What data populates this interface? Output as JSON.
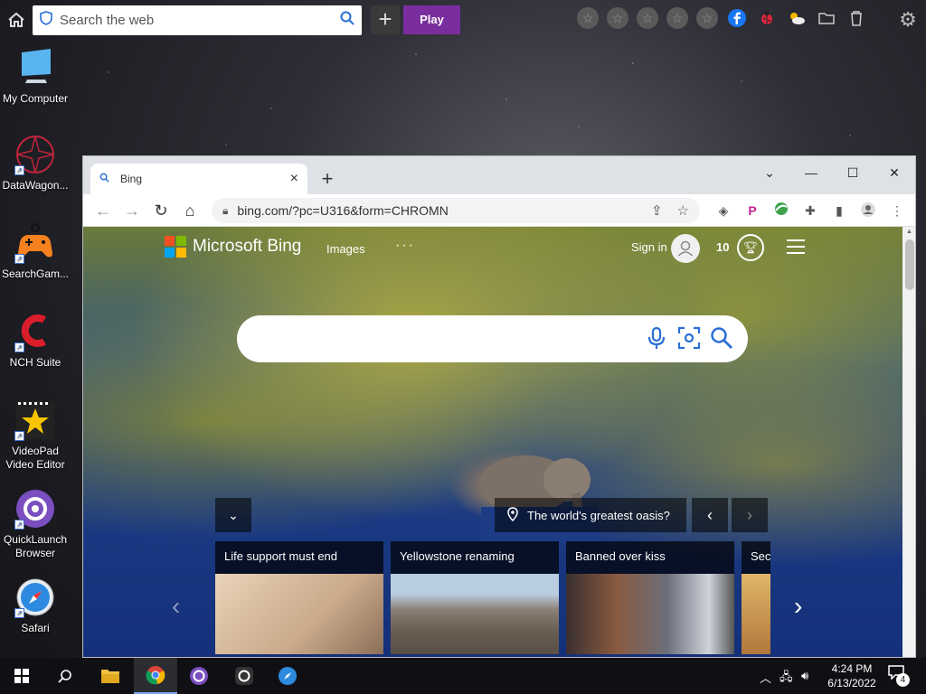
{
  "toolbar": {
    "search_placeholder": "Search the web",
    "play_label": "Play"
  },
  "desktop_icons": [
    {
      "label": "My Computer"
    },
    {
      "label": "DataWagon..."
    },
    {
      "label": "SearchGam..."
    },
    {
      "label": "NCH Suite"
    },
    {
      "label": "VideoPad Video Editor"
    },
    {
      "label": "QuickLaunch Browser"
    },
    {
      "label": "Safari"
    }
  ],
  "browser": {
    "tab_title": "Bing",
    "url": "bing.com/?pc=U316&form=CHROMN"
  },
  "bing": {
    "brand": "Microsoft Bing",
    "nav_images": "Images",
    "nav_more": "···",
    "sign_in": "Sign in",
    "points": "10",
    "caption": "The world's greatest oasis?",
    "cards": [
      {
        "title": "Life support must end"
      },
      {
        "title": "Yellowstone renaming"
      },
      {
        "title": "Banned over kiss"
      },
      {
        "title": "Sec"
      }
    ]
  },
  "taskbar": {
    "time": "4:24 PM",
    "date": "6/13/2022",
    "notification_count": "4"
  },
  "colors": {
    "play_button": "#7a2e9e",
    "ms_red": "#f25022",
    "ms_green": "#7fba00",
    "ms_blue": "#00a4ef",
    "ms_yellow": "#ffb900",
    "bing_icon_blue": "#2a6ed6"
  }
}
